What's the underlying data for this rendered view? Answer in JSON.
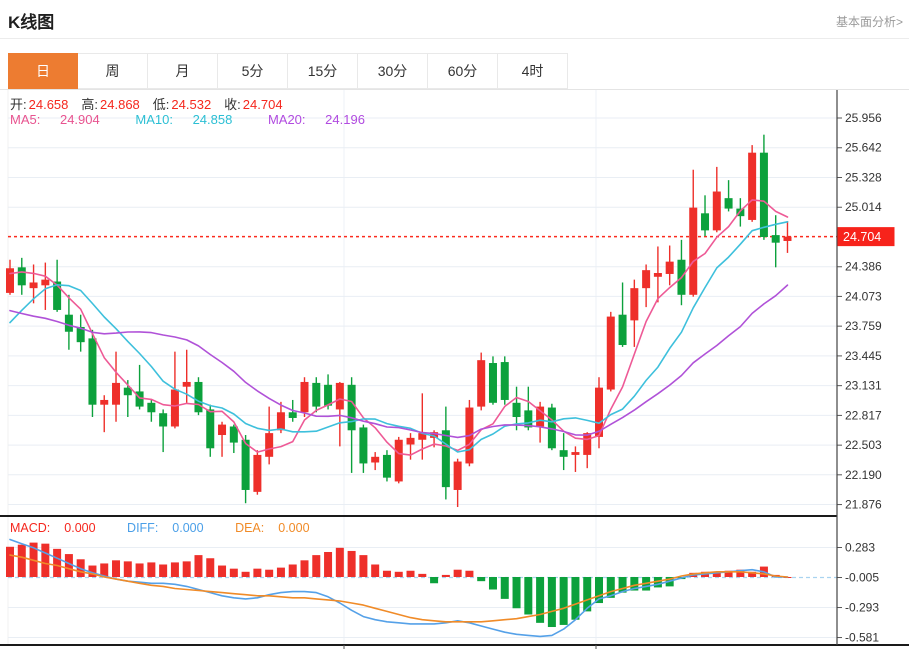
{
  "header": {
    "title": "K线图",
    "link": "基本面分析>"
  },
  "tabs": {
    "items": [
      {
        "label": "日",
        "active": true
      },
      {
        "label": "周",
        "active": false
      },
      {
        "label": "月",
        "active": false
      },
      {
        "label": "5分",
        "active": false
      },
      {
        "label": "15分",
        "active": false
      },
      {
        "label": "30分",
        "active": false
      },
      {
        "label": "60分",
        "active": false
      },
      {
        "label": "4时",
        "active": false
      }
    ]
  },
  "info": {
    "ohlc": [
      {
        "label": "开:",
        "value": "24.658"
      },
      {
        "label": "高:",
        "value": "24.868"
      },
      {
        "label": "低:",
        "value": "24.532"
      },
      {
        "label": "收:",
        "value": "24.704"
      }
    ],
    "ma": [
      {
        "label": "MA5:",
        "value": "24.904"
      },
      {
        "label": "MA10:",
        "value": "24.858"
      },
      {
        "label": "MA20:",
        "value": "24.196"
      }
    ]
  },
  "macd_info": [
    {
      "label": "MACD:",
      "value": "0.000"
    },
    {
      "label": "DIFF:",
      "value": "0.000"
    },
    {
      "label": "DEA:",
      "value": "0.000"
    }
  ],
  "colors": {
    "up": "#ee2f2a",
    "down": "#0ca13c",
    "ma5": "#ee5a96",
    "ma10": "#3ec0dc",
    "ma20": "#b052d8",
    "diff": "#55a1e8",
    "dea": "#f08b28",
    "tab_accent": "#ed7c31",
    "price_line": "#fb2b1e",
    "price_tag_bg": "#f7231b",
    "price_tag_text": "#ffffff",
    "grid": "#e9eef4",
    "axis": "#444444",
    "zero_dash": "#a9d3f0"
  },
  "chart_data": {
    "type": "candlestick",
    "title": "K线图 (日)",
    "indicator": "MACD",
    "legend": [
      "MA5",
      "MA10",
      "MA20"
    ],
    "price_axis": {
      "max": 25.956,
      "min": 21.876,
      "step": 0.314,
      "ticks": [
        "25.956",
        "25.642",
        "25.328",
        "25.014",
        "24.386",
        "24.073",
        "23.759",
        "23.445",
        "23.131",
        "22.817",
        "22.503",
        "22.190",
        "21.876"
      ],
      "current_label": "24.704",
      "current_value": 24.704
    },
    "candles": [
      [
        24.11,
        24.46,
        24.09,
        24.37
      ],
      [
        24.38,
        24.48,
        24.09,
        24.19
      ],
      [
        24.16,
        24.41,
        24.0,
        24.22
      ],
      [
        24.19,
        24.43,
        23.93,
        24.25
      ],
      [
        24.23,
        24.46,
        23.91,
        23.93
      ],
      [
        23.88,
        24.09,
        23.51,
        23.7
      ],
      [
        23.75,
        23.88,
        23.49,
        23.59
      ],
      [
        23.63,
        23.72,
        22.8,
        22.93
      ],
      [
        22.93,
        23.03,
        22.64,
        22.98
      ],
      [
        22.93,
        23.49,
        22.75,
        23.16
      ],
      [
        23.11,
        23.19,
        22.8,
        23.03
      ],
      [
        23.07,
        23.35,
        22.88,
        22.91
      ],
      [
        22.95,
        22.98,
        22.75,
        22.85
      ],
      [
        22.84,
        22.88,
        22.43,
        22.7
      ],
      [
        22.7,
        23.49,
        22.68,
        23.09
      ],
      [
        23.12,
        23.51,
        22.95,
        23.17
      ],
      [
        23.17,
        23.22,
        22.82,
        22.85
      ],
      [
        22.88,
        22.93,
        22.38,
        22.47
      ],
      [
        22.61,
        22.75,
        22.38,
        22.72
      ],
      [
        22.7,
        22.72,
        22.42,
        22.53
      ],
      [
        22.56,
        22.61,
        21.89,
        22.03
      ],
      [
        22.01,
        22.45,
        21.98,
        22.4
      ],
      [
        22.38,
        22.91,
        22.3,
        22.63
      ],
      [
        22.66,
        22.96,
        22.63,
        22.85
      ],
      [
        22.85,
        22.98,
        22.75,
        22.79
      ],
      [
        22.85,
        23.22,
        22.8,
        23.17
      ],
      [
        23.16,
        23.22,
        22.85,
        22.91
      ],
      [
        23.14,
        23.25,
        22.88,
        22.92
      ],
      [
        22.88,
        23.17,
        22.49,
        23.16
      ],
      [
        23.14,
        23.22,
        22.21,
        22.66
      ],
      [
        22.69,
        22.72,
        22.21,
        22.31
      ],
      [
        22.32,
        22.43,
        22.24,
        22.38
      ],
      [
        22.4,
        22.45,
        22.12,
        22.16
      ],
      [
        22.12,
        22.59,
        22.1,
        22.56
      ],
      [
        22.51,
        22.63,
        22.35,
        22.58
      ],
      [
        22.56,
        23.05,
        22.35,
        22.63
      ],
      [
        22.58,
        22.66,
        22.48,
        22.64
      ],
      [
        22.66,
        22.91,
        21.93,
        22.06
      ],
      [
        22.03,
        22.36,
        21.85,
        22.33
      ],
      [
        22.31,
        22.98,
        22.28,
        22.9
      ],
      [
        22.91,
        23.48,
        22.87,
        23.4
      ],
      [
        23.37,
        23.44,
        22.93,
        22.95
      ],
      [
        23.38,
        23.44,
        22.93,
        22.98
      ],
      [
        22.95,
        23.12,
        22.66,
        22.8
      ],
      [
        22.87,
        23.12,
        22.66,
        22.69
      ],
      [
        22.7,
        22.96,
        22.53,
        22.91
      ],
      [
        22.9,
        22.94,
        22.45,
        22.47
      ],
      [
        22.45,
        22.63,
        22.24,
        22.38
      ],
      [
        22.4,
        22.49,
        22.22,
        22.43
      ],
      [
        22.4,
        22.64,
        22.26,
        22.63
      ],
      [
        22.59,
        23.22,
        22.47,
        23.11
      ],
      [
        23.09,
        23.91,
        23.07,
        23.86
      ],
      [
        23.88,
        24.22,
        23.54,
        23.56
      ],
      [
        23.82,
        24.25,
        23.54,
        24.16
      ],
      [
        24.16,
        24.41,
        23.96,
        24.35
      ],
      [
        24.28,
        24.6,
        24.01,
        24.32
      ],
      [
        24.31,
        24.61,
        24.19,
        24.44
      ],
      [
        24.46,
        24.67,
        23.98,
        24.09
      ],
      [
        24.09,
        25.41,
        24.07,
        25.01
      ],
      [
        24.95,
        25.14,
        24.71,
        24.77
      ],
      [
        24.77,
        25.44,
        24.75,
        25.18
      ],
      [
        25.11,
        25.3,
        24.97,
        25.0
      ],
      [
        25.0,
        25.11,
        24.81,
        24.92
      ],
      [
        24.88,
        25.67,
        24.86,
        25.59
      ],
      [
        25.59,
        25.78,
        24.67,
        24.7
      ],
      [
        24.72,
        24.93,
        24.38,
        24.64
      ],
      [
        24.658,
        24.868,
        24.532,
        24.704
      ]
    ],
    "ma_periods": [
      5,
      10,
      20
    ],
    "prehistory_closes": [
      24.8,
      24.8,
      24.7,
      24.6,
      24.5,
      24.2,
      23.8,
      23.3,
      23.0,
      22.8,
      22.9,
      23.0,
      23.2,
      23.5,
      23.8,
      24.1,
      24.3,
      24.4,
      24.4
    ],
    "macd": {
      "axis_ticks": [
        "0.283",
        "-0.005",
        "-0.293",
        "-0.581"
      ],
      "hist": [
        0.29,
        0.31,
        0.33,
        0.32,
        0.27,
        0.22,
        0.17,
        0.11,
        0.13,
        0.16,
        0.15,
        0.13,
        0.14,
        0.12,
        0.14,
        0.15,
        0.21,
        0.18,
        0.11,
        0.08,
        0.05,
        0.08,
        0.07,
        0.09,
        0.12,
        0.16,
        0.21,
        0.24,
        0.28,
        0.25,
        0.21,
        0.12,
        0.06,
        0.05,
        0.06,
        0.03,
        -0.06,
        0.02,
        0.07,
        0.06,
        -0.04,
        -0.12,
        -0.21,
        -0.3,
        -0.36,
        -0.44,
        -0.48,
        -0.46,
        -0.41,
        -0.33,
        -0.25,
        -0.2,
        -0.15,
        -0.13,
        -0.13,
        -0.1,
        -0.09,
        -0.02,
        0.04,
        0.05,
        0.04,
        0.06,
        0.07,
        0.05,
        0.1,
        0.02,
        0.0
      ],
      "diff": [
        0.36,
        0.32,
        0.28,
        0.23,
        0.18,
        0.13,
        0.08,
        0.04,
        0.01,
        -0.02,
        -0.04,
        -0.05,
        -0.06,
        -0.06,
        -0.07,
        -0.09,
        -0.12,
        -0.15,
        -0.18,
        -0.2,
        -0.21,
        -0.2,
        -0.17,
        -0.15,
        -0.14,
        -0.14,
        -0.15,
        -0.19,
        -0.25,
        -0.32,
        -0.38,
        -0.41,
        -0.43,
        -0.44,
        -0.45,
        -0.45,
        -0.45,
        -0.44,
        -0.42,
        -0.44,
        -0.47,
        -0.5,
        -0.53,
        -0.55,
        -0.56,
        -0.57,
        -0.56,
        -0.5,
        -0.41,
        -0.3,
        -0.21,
        -0.18,
        -0.14,
        -0.11,
        -0.09,
        -0.07,
        -0.04,
        -0.01,
        0.02,
        0.03,
        0.04,
        0.05,
        0.06,
        0.07,
        0.05,
        0.0,
        0.0
      ],
      "dea": [
        0.21,
        0.19,
        0.16,
        0.13,
        0.11,
        0.08,
        0.05,
        0.03,
        0.0,
        -0.02,
        -0.04,
        -0.06,
        -0.08,
        -0.09,
        -0.11,
        -0.12,
        -0.13,
        -0.14,
        -0.15,
        -0.16,
        -0.17,
        -0.18,
        -0.18,
        -0.19,
        -0.2,
        -0.2,
        -0.21,
        -0.22,
        -0.23,
        -0.25,
        -0.27,
        -0.3,
        -0.33,
        -0.36,
        -0.39,
        -0.41,
        -0.42,
        -0.43,
        -0.43,
        -0.43,
        -0.43,
        -0.42,
        -0.41,
        -0.4,
        -0.38,
        -0.36,
        -0.33,
        -0.3,
        -0.26,
        -0.22,
        -0.18,
        -0.14,
        -0.11,
        -0.08,
        -0.06,
        -0.04,
        -0.02,
        0.01,
        0.03,
        0.04,
        0.05,
        0.05,
        0.05,
        0.04,
        0.03,
        0.01,
        0.0
      ]
    }
  }
}
